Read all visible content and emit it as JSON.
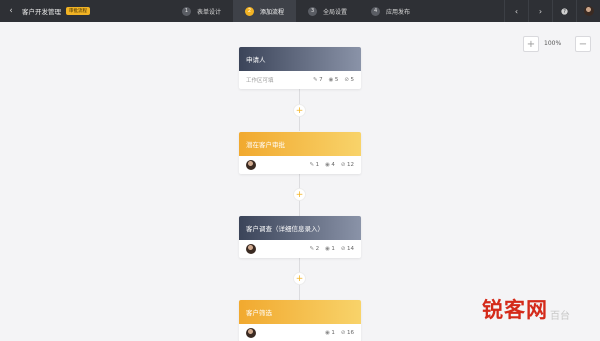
{
  "header": {
    "app_title": "客户开发管理",
    "badge": "审批流程",
    "steps": [
      {
        "num": "1",
        "label": "表单设计",
        "active": false
      },
      {
        "num": "2",
        "label": "添加流程",
        "active": true
      },
      {
        "num": "3",
        "label": "全局设置",
        "active": false
      },
      {
        "num": "4",
        "label": "应用发布",
        "active": false
      }
    ]
  },
  "zoom": {
    "level": "100%"
  },
  "nodes": [
    {
      "title": "申请人",
      "style": "dark",
      "body_text": "工作区可填",
      "stats": {
        "edit": "7",
        "view": "5",
        "hidden": "5"
      }
    },
    {
      "title": "潜在客户审批",
      "style": "gold",
      "stats": {
        "edit": "1",
        "view": "4",
        "hidden": "12"
      }
    },
    {
      "title": "客户调查（详细信息录入）",
      "style": "dark",
      "stats": {
        "edit": "2",
        "view": "1",
        "hidden": "14"
      }
    },
    {
      "title": "客户筛选",
      "style": "gold",
      "stats": {
        "view": "1",
        "hidden": "16"
      }
    }
  ],
  "watermark": {
    "main": "锐客网",
    "sub": "百台"
  },
  "icons": {
    "back": "chevron-left-icon",
    "add": "plus-icon",
    "edit": "pencil-icon",
    "view": "eye-icon",
    "hidden": "eye-off-icon"
  }
}
